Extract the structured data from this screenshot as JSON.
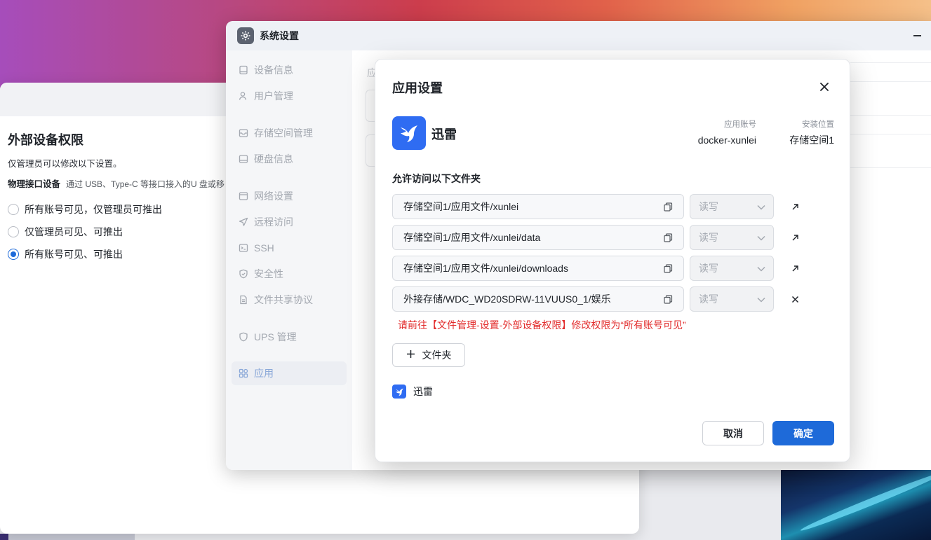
{
  "back_window": {
    "title": "外部设备权限",
    "desc": "仅管理员可以修改以下设置。",
    "physical_label": "物理接口设备",
    "physical_desc": "通过 USB、Type-C 等接口接入的U 盘或移",
    "options": [
      {
        "label": "所有账号可见，仅管理员可推出",
        "checked": false
      },
      {
        "label": "仅管理员可见、可推出",
        "checked": false
      },
      {
        "label": "所有账号可见、可推出",
        "checked": true
      }
    ]
  },
  "system_settings": {
    "title": "系统设置",
    "content_label": "应",
    "sidebar": [
      {
        "label": "设备信息",
        "icon": "device-icon"
      },
      {
        "label": "用户管理",
        "icon": "user-icon"
      },
      {
        "label": "存储空间管理",
        "icon": "storage-icon"
      },
      {
        "label": "硬盘信息",
        "icon": "disk-icon"
      },
      {
        "label": "网络设置",
        "icon": "network-icon"
      },
      {
        "label": "远程访问",
        "icon": "remote-icon"
      },
      {
        "label": "SSH",
        "icon": "ssh-icon"
      },
      {
        "label": "安全性",
        "icon": "shield-icon"
      },
      {
        "label": "文件共享协议",
        "icon": "file-share-icon"
      },
      {
        "label": "UPS 管理",
        "icon": "ups-icon"
      },
      {
        "label": "应用",
        "icon": "apps-icon",
        "active": true
      }
    ]
  },
  "dialog": {
    "title": "应用设置",
    "app_name": "迅雷",
    "account_label": "应用账号",
    "account_value": "docker-xunlei",
    "location_label": "安装位置",
    "location_value": "存储空间1",
    "folders_label": "允许访问以下文件夹",
    "folders": [
      {
        "path": "存储空间1/应用文件/xunlei",
        "permission": "读写",
        "action": "open-icon"
      },
      {
        "path": "存储空间1/应用文件/xunlei/data",
        "permission": "读写",
        "action": "open-icon"
      },
      {
        "path": "存储空间1/应用文件/xunlei/downloads",
        "permission": "读写",
        "action": "open-icon"
      },
      {
        "path": "外接存储/WDC_WD20SDRW-11VUUS0_1/娱乐",
        "permission": "读写",
        "action": "remove-icon"
      }
    ],
    "warning": "请前往【文件管理-设置-外部设备权限】修改权限为“所有账号可见”",
    "add_folder": "文件夹",
    "footer_app": "迅雷",
    "cancel": "取消",
    "confirm": "确定"
  },
  "colors": {
    "accent": "#1e6ad9",
    "warning": "#e22b2b",
    "app_logo": "#2f6cf2"
  }
}
